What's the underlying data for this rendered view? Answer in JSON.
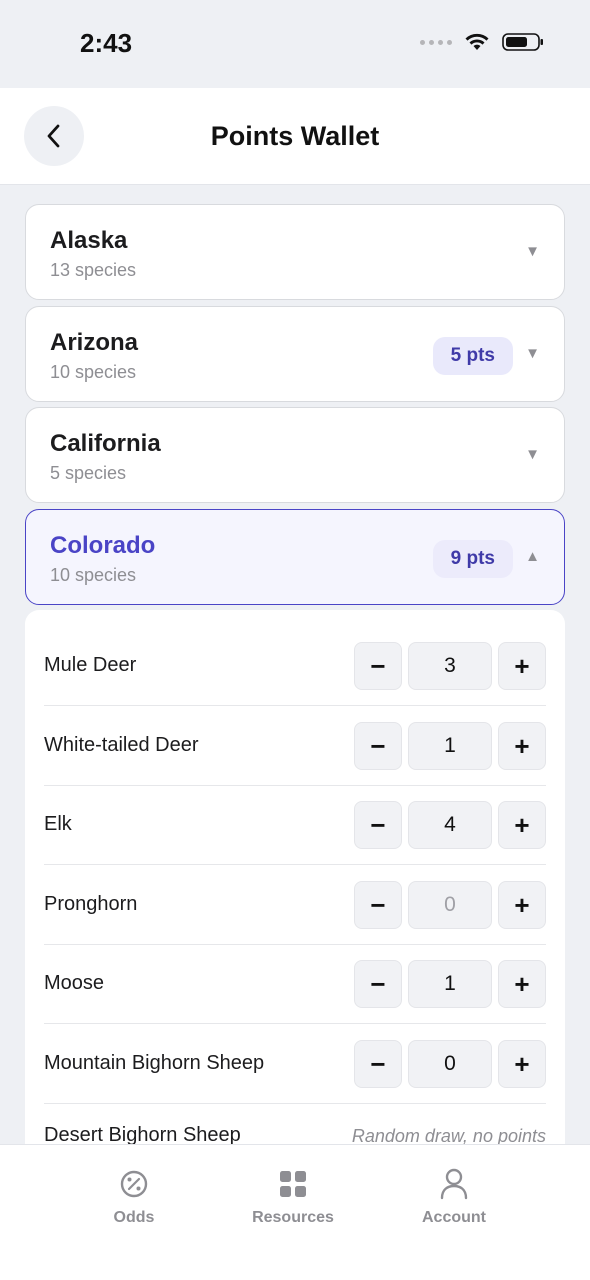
{
  "status_bar": {
    "time": "2:43"
  },
  "header": {
    "title": "Points Wallet"
  },
  "states": [
    {
      "name": "Alaska",
      "species_count": "13 species",
      "points": ""
    },
    {
      "name": "Arizona",
      "species_count": "10 species",
      "points": "5 pts"
    },
    {
      "name": "California",
      "species_count": "5 species",
      "points": ""
    },
    {
      "name": "Colorado",
      "species_count": "10 species",
      "points": "9 pts"
    }
  ],
  "species": [
    {
      "name": "Mule Deer",
      "value": "3"
    },
    {
      "name": "White-tailed Deer",
      "value": "1"
    },
    {
      "name": "Elk",
      "value": "4"
    },
    {
      "name": "Pronghorn",
      "value": "0"
    },
    {
      "name": "Moose",
      "value": "1"
    },
    {
      "name": "Mountain Bighorn Sheep",
      "value": "0"
    },
    {
      "name": "Desert Bighorn Sheep",
      "note": "Random draw, no points"
    }
  ],
  "stepper": {
    "minus": "−",
    "plus": "+"
  },
  "tabs": [
    {
      "label": "Odds",
      "icon": "percent-circle-icon"
    },
    {
      "label": "Resources",
      "icon": "grid-icon"
    },
    {
      "label": "Account",
      "icon": "person-icon"
    }
  ],
  "colors": {
    "accent": "#4a44c6",
    "badge_bg": "#e9e9fb",
    "muted": "#8e8e93"
  }
}
